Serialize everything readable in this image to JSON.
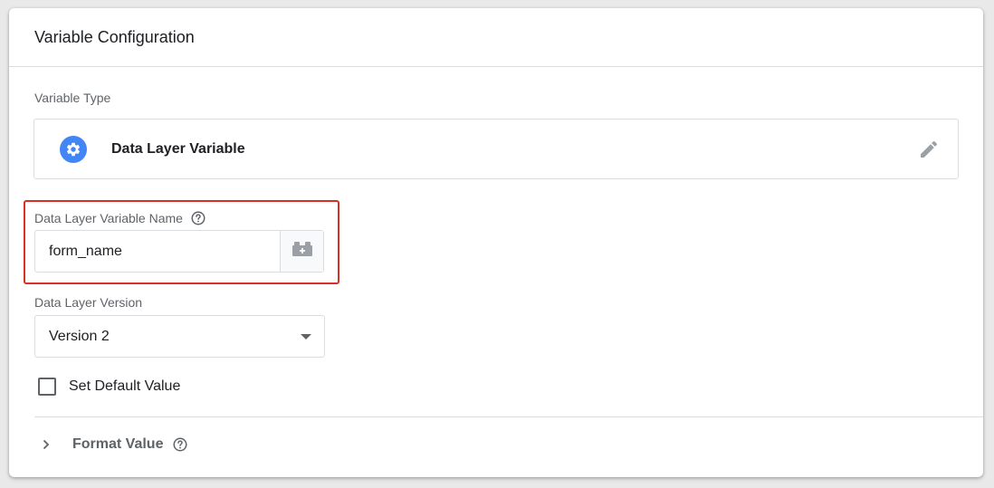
{
  "card": {
    "title": "Variable Configuration"
  },
  "variable_type": {
    "label": "Variable Type",
    "name": "Data Layer Variable",
    "icon": "gear-icon",
    "icon_color": "#4285f4",
    "edit_icon": "pencil-icon"
  },
  "dl_name": {
    "label": "Data Layer Variable Name",
    "value": "form_name",
    "help_icon": "help-icon",
    "picker_icon": "variable-block-icon",
    "highlight_color": "#d93025"
  },
  "dl_version": {
    "label": "Data Layer Version",
    "value": "Version 2"
  },
  "default_value": {
    "label": "Set Default Value",
    "checked": false
  },
  "format_value": {
    "label": "Format Value",
    "help_icon": "help-icon",
    "expanded": false
  }
}
